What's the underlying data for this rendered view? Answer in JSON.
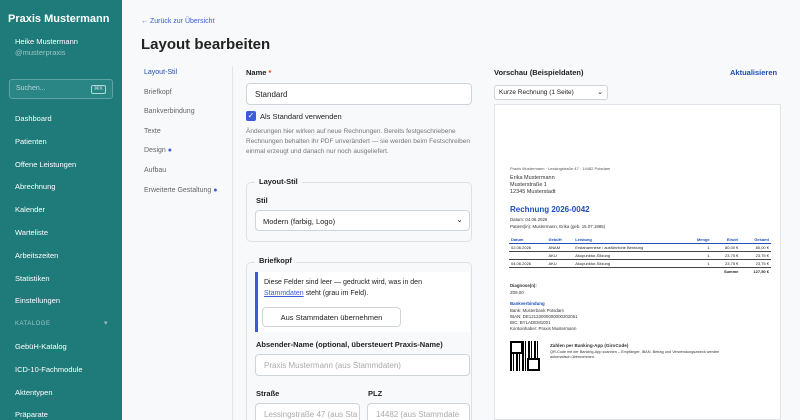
{
  "sidebar": {
    "brand": "Praxis Mustermann",
    "user_name": "Heike Mustermann",
    "user_handle": "@musterpraxis",
    "search_placeholder": "Suchen...",
    "search_shortcut": "⌘K",
    "items": [
      "Dashboard",
      "Patienten",
      "Offene Leistungen",
      "Abrechnung",
      "Kalender",
      "Warteliste",
      "Arbeitszeiten",
      "Statistiken",
      "Einstellungen"
    ],
    "section": "KATALOGE",
    "catalog_items": [
      "GebüH-Katalog",
      "ICD-10-Fachmodule",
      "Aktentypen",
      "Präparate"
    ]
  },
  "header": {
    "back": "← Zurück zur Übersicht",
    "title": "Layout bearbeiten"
  },
  "subnav": [
    "Layout-Stil",
    "Briefkopf",
    "Bankverbindung",
    "Texte",
    "Design",
    "Aufbau",
    "Erweiterte Gestaltung"
  ],
  "form": {
    "name_label": "Name",
    "name_required": "*",
    "name_value": "Standard",
    "default_checkbox": "Als Standard verwenden",
    "hint": "Änderungen hier wirken auf neue Rechnungen. Bereits festgeschriebene Rechnungen behalten ihr PDF unverändert — sie werden beim Festschreiben einmal erzeugt und danach nur noch ausgeliefert.",
    "layout_legend": "Layout-Stil",
    "style_label": "Stil",
    "style_value": "Modern (farbig, Logo)",
    "letterhead_legend": "Briefkopf",
    "info_text_1": "Diese Felder sind leer — gedruckt wird, was in den",
    "info_link": "Stammdaten",
    "info_text_2": "steht (grau im Feld).",
    "info_button": "Aus Stammdaten übernehmen",
    "sender_label": "Absender-Name (optional, übersteuert Praxis-Name)",
    "sender_placeholder": "Praxis Mustermann (aus Stammdaten)",
    "street_label": "Straße",
    "street_placeholder": "Lessingstraße 47 (aus Sta",
    "zip_label": "PLZ",
    "zip_placeholder": "14482 (aus Stammdate"
  },
  "preview": {
    "heading": "Vorschau (Beispieldaten)",
    "refresh": "Aktualisieren",
    "select_value": "Kurze Rechnung (1 Seite)",
    "sender_line": "Praxis Mustermann · Lessingstraße 47 · 14482 Potsdam",
    "recipient": [
      "Erika Mustermann",
      "Musterstraße 1",
      "12345 Musterstadt"
    ],
    "invoice_title": "Rechnung 2026-0042",
    "date_line": "Datum: 04.06.2026",
    "patient_line": "Patient(in): Mustermann, Erika (geb. 15.07.1985)",
    "table_headers": [
      "Datum",
      "GebüH",
      "Leistung",
      "Menge",
      "Einzel",
      "Gesamt"
    ],
    "rows": [
      [
        "02.06.2026",
        "ANAM",
        "Erstanamnese / ausführliche Beratung",
        "1",
        "80,00 €",
        "80,00 €"
      ],
      [
        "",
        "AKU",
        "Akupunktur-Sitzung",
        "1",
        "23,75 €",
        "23,75 €"
      ],
      [
        "04.06.2026",
        "AKU",
        "Akupunktur-Sitzung",
        "1",
        "23,75 €",
        "23,75 €"
      ]
    ],
    "sum_label": "Summe",
    "sum_value": "127,50 €",
    "diagnosis_label": "Diagnose(n):",
    "diagnosis_value": "Z09.00",
    "bank_label": "Bankverbindung",
    "bank_lines": [
      "Bank: Musterbank Potsdam",
      "IBAN: DE12123000000000202051",
      "BIC: BYLADEM1001",
      "Kontoinhaber: Praxis Mustermann"
    ],
    "qr_title": "Zahlen per Banking-App (GiroCode)",
    "qr_text_1": "QR-Code mit der Banking-App scannen – Empfänger, IBAN, Betrag und Verwendungszweck werden",
    "qr_text_2": "automatisch übernommen."
  }
}
